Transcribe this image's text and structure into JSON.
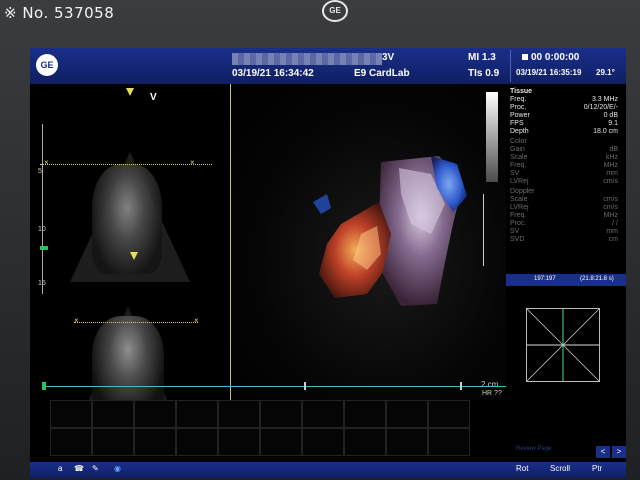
{
  "watermark": "※ No. 537058",
  "brand": {
    "monitor_logo": "GE",
    "header_logo": "GE"
  },
  "header": {
    "mode": "3V",
    "exam_datetime": "03/19/21 16:34:42",
    "preset": "E9 CardLab",
    "mi": "MI 1.3",
    "tis": "TIs 0.9",
    "timer": "00 0:00:00",
    "current_datetime": "03/19/21 16:35:19",
    "temperature": "29.1°"
  },
  "left_panel": {
    "orientation_marker": "V",
    "depth_ticks": [
      "5",
      "10",
      "15"
    ]
  },
  "params": {
    "section_tissue": "Tissue",
    "tissue": [
      {
        "label": "Freq.",
        "value": "3.3 MHz"
      },
      {
        "label": "Proc.",
        "value": "0/12/20/E/-"
      },
      {
        "label": "Power",
        "value": "0 dB"
      },
      {
        "label": "FPS",
        "value": "9.1"
      },
      {
        "label": "Depth",
        "value": "18.0 cm"
      }
    ],
    "section_color": "Color",
    "color": [
      {
        "label": "Gain",
        "value": "dB"
      },
      {
        "label": "Scale",
        "value": "kHz"
      },
      {
        "label": "Freq.",
        "value": "MHz"
      },
      {
        "label": "SV",
        "value": "mm"
      },
      {
        "label": "LVRej",
        "value": "cm/s"
      }
    ],
    "section_doppler": "Doppler",
    "doppler": [
      {
        "label": "Scale",
        "value": "cm/s"
      },
      {
        "label": "LVRej",
        "value": "cm/s"
      },
      {
        "label": "Freq.",
        "value": "MHz"
      },
      {
        "label": "Proc.",
        "value": "/ /"
      },
      {
        "label": "SV",
        "value": "mm"
      },
      {
        "label": "SVD",
        "value": "cm"
      }
    ]
  },
  "frame_counter": {
    "frame": "197:197",
    "time": "(21.8:21.8 s)"
  },
  "scale": {
    "bar_label": "2 cm",
    "hr": "HR ??"
  },
  "footer": {
    "btn_rot": "Rot",
    "btn_scroll": "Scroll",
    "btn_ptr": "Ptr",
    "hint": "Review Page",
    "prev": "<",
    "next": ">",
    "icons": [
      "a",
      "☎",
      "✎",
      "◉"
    ]
  },
  "colors": {
    "header_blue": "#1a2f8a",
    "accent_cyan": "#3ac0c9",
    "marker_yellow": "#e8dd5a"
  }
}
